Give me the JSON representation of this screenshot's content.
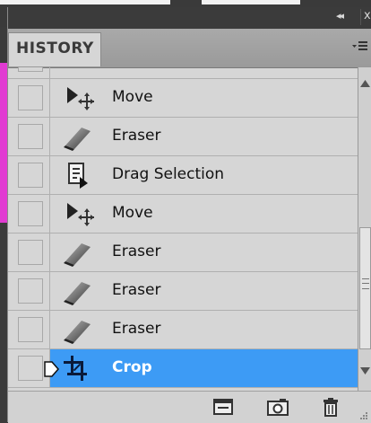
{
  "panel": {
    "tab_label": "HISTORY",
    "collapse_label": "◂◂",
    "close_label": "x"
  },
  "history": [
    {
      "label": "Move",
      "icon": "move-tool-icon",
      "selected": false
    },
    {
      "label": "Eraser",
      "icon": "eraser-icon",
      "selected": false
    },
    {
      "label": "Drag Selection",
      "icon": "drag-selection-icon",
      "selected": false
    },
    {
      "label": "Move",
      "icon": "move-tool-icon",
      "selected": false
    },
    {
      "label": "Eraser",
      "icon": "eraser-icon",
      "selected": false
    },
    {
      "label": "Eraser",
      "icon": "eraser-icon",
      "selected": false
    },
    {
      "label": "Eraser",
      "icon": "eraser-icon",
      "selected": false
    },
    {
      "label": "Crop",
      "icon": "crop-tool-icon",
      "selected": true
    }
  ],
  "colors": {
    "selected": "#3d9bf5",
    "panel_bg": "#d6d6d6"
  }
}
